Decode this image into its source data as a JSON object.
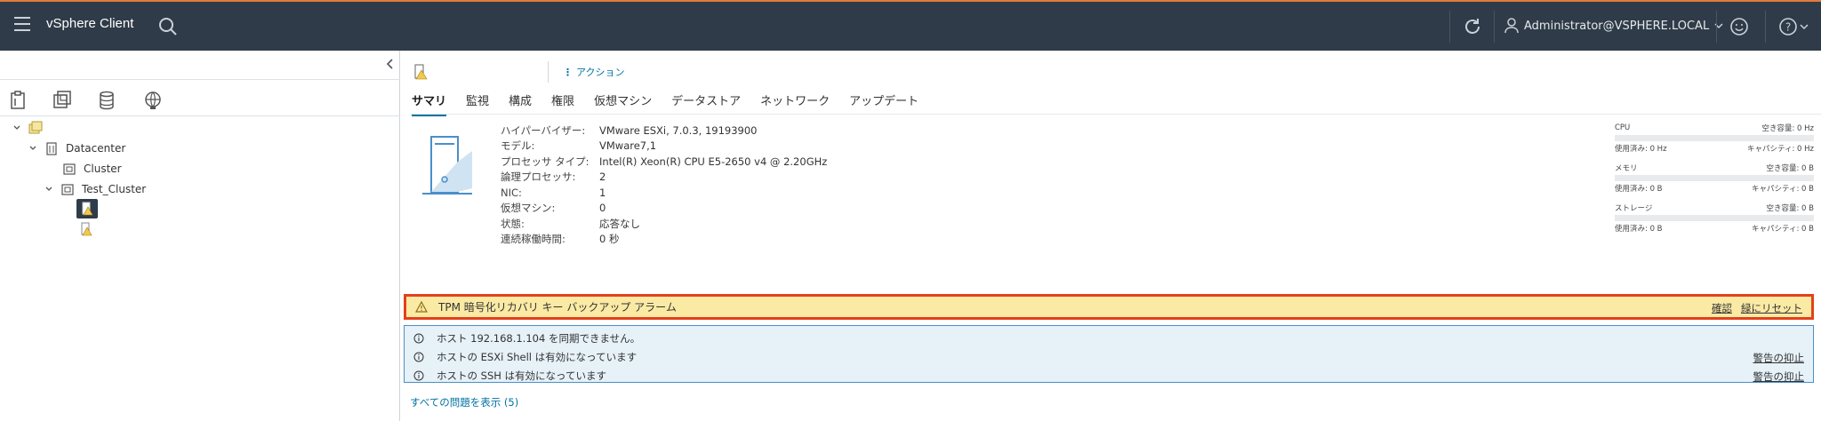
{
  "header": {
    "app_title": "vSphere Client",
    "user": "Administrator@VSPHERE.LOCAL",
    "colors": {
      "bar": "#2f3b48",
      "accent": "#e07b39"
    }
  },
  "left_nav": {
    "icons": [
      "hosts-clusters-icon",
      "vms-templates-icon",
      "storage-icon",
      "networking-icon"
    ],
    "tree": {
      "datacenter": "Datacenter",
      "cluster": "Cluster",
      "test_cluster": "Test_Cluster"
    }
  },
  "main": {
    "actions_label": "アクション",
    "tabs": [
      {
        "label": "サマリ",
        "active": true
      },
      {
        "label": "監視"
      },
      {
        "label": "構成"
      },
      {
        "label": "権限"
      },
      {
        "label": "仮想マシン"
      },
      {
        "label": "データストア"
      },
      {
        "label": "ネットワーク"
      },
      {
        "label": "アップデート"
      }
    ],
    "properties": [
      {
        "label": "ハイパーバイザー:",
        "value": "VMware ESXi, 7.0.3, 19193900"
      },
      {
        "label": "モデル:",
        "value": "VMware7,1"
      },
      {
        "label": "プロセッサ タイプ:",
        "value": "Intel(R) Xeon(R) CPU E5-2650 v4 @ 2.20GHz"
      },
      {
        "label": "論理プロセッサ:",
        "value": "2"
      },
      {
        "label": "NIC:",
        "value": "1"
      },
      {
        "label": "仮想マシン:",
        "value": "0"
      },
      {
        "label": "状態:",
        "value": "応答なし"
      },
      {
        "label": "連続稼働時間:",
        "value": "0 秒"
      }
    ],
    "resources": [
      {
        "name": "CPU",
        "free": "空き容量: 0 Hz",
        "used": "使用済み: 0 Hz",
        "capacity": "キャパシティ: 0 Hz"
      },
      {
        "name": "メモリ",
        "free": "空き容量: 0 B",
        "used": "使用済み: 0 B",
        "capacity": "キャパシティ: 0 B"
      },
      {
        "name": "ストレージ",
        "free": "空き容量: 0 B",
        "used": "使用済み: 0 B",
        "capacity": "キャパシティ: 0 B"
      }
    ],
    "alarm": {
      "text": "TPM 暗号化リカバリ キー バックアップ アラーム",
      "ack_label": "確認",
      "reset_label": "緑にリセット"
    },
    "info": [
      {
        "text": "ホスト 192.168.1.104 を同期できません。",
        "action": ""
      },
      {
        "text": "ホストの ESXi Shell は有効になっています",
        "action": "警告の抑止"
      },
      {
        "text": "ホストの SSH は有効になっています",
        "action": "警告の抑止"
      }
    ],
    "show_all": "すべての問題を表示 (5)"
  }
}
